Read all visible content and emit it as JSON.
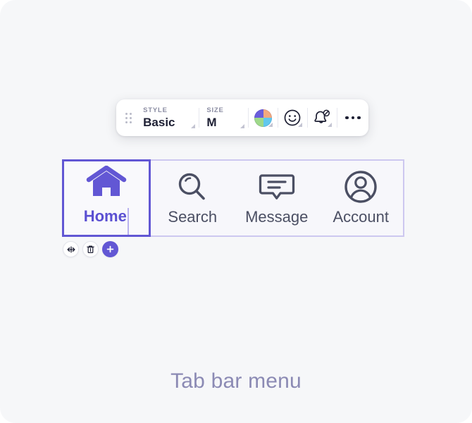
{
  "page": {
    "background_color": "#f6f7f9",
    "caption": "Tab bar menu",
    "accent_color": "#6257d4",
    "caption_color": "#8b8ab4"
  },
  "toolbar": {
    "drag_handle_icon": "drag-dots-icon",
    "fields": [
      {
        "label": "STYLE",
        "value": "Basic",
        "icon": "chevron-down-icon"
      },
      {
        "label": "SIZE",
        "value": "M",
        "icon": "chevron-down-icon"
      }
    ],
    "buttons": [
      {
        "name": "color-wheel-icon",
        "label": ""
      },
      {
        "name": "smiley-icon",
        "label": ""
      },
      {
        "name": "bell-muted-icon",
        "label": ""
      },
      {
        "name": "more-options-icon",
        "label": ""
      }
    ]
  },
  "tabbar": {
    "border_color": "#cdc8f0",
    "selected_border_color": "#6257d4",
    "tabs": [
      {
        "label": "Home",
        "icon": "home-icon",
        "selected": true
      },
      {
        "label": "Search",
        "icon": "search-icon",
        "selected": false
      },
      {
        "label": "Message",
        "icon": "message-icon",
        "selected": false
      },
      {
        "label": "Account",
        "icon": "account-icon",
        "selected": false
      }
    ]
  },
  "actions": [
    {
      "name": "resize-width-button",
      "icon": "horizontal-resize-icon"
    },
    {
      "name": "delete-button",
      "icon": "trash-icon"
    },
    {
      "name": "add-tab-button",
      "icon": "plus-icon"
    }
  ]
}
